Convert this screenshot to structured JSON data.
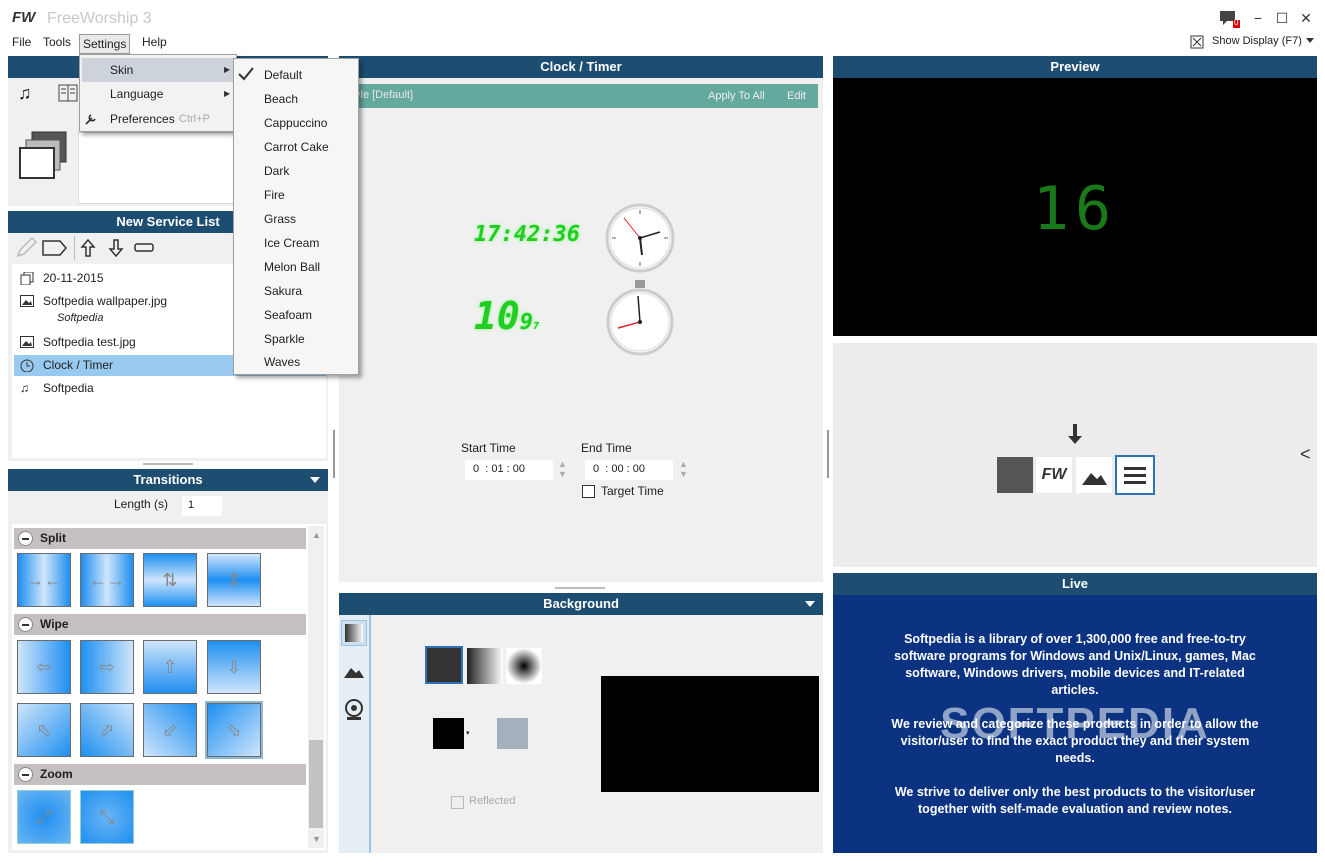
{
  "app": {
    "logo": "FW",
    "title": "FreeWorship 3"
  },
  "window_controls": {
    "notify": "0",
    "minimize": "−",
    "maximize": "☐",
    "close": "✕"
  },
  "menubar": [
    {
      "label": "File"
    },
    {
      "label": "Tools"
    },
    {
      "label": "Settings"
    },
    {
      "label": "Help"
    }
  ],
  "show_display": {
    "label": "Show Display (F7)"
  },
  "settings_menu": {
    "skin": "Skin",
    "language": "Language",
    "preferences": "Preferences",
    "preferences_shortcut": "Ctrl+P"
  },
  "skins": [
    "Default",
    "Beach",
    "Cappuccino",
    "Carrot Cake",
    "Dark",
    "Fire",
    "Grass",
    "Ice Cream",
    "Melon Ball",
    "Sakura",
    "Seafoam",
    "Sparkle",
    "Waves"
  ],
  "selected_skin": "Default",
  "service_list": {
    "title": "New Service List",
    "items": [
      {
        "label": "20-11-2015",
        "sub": "",
        "icon": "pages-icon"
      },
      {
        "label": "Softpedia wallpaper.jpg",
        "sub": "Softpedia",
        "icon": "image-icon"
      },
      {
        "label": "Softpedia test.jpg",
        "sub": "",
        "icon": "image-icon"
      },
      {
        "label": "Clock / Timer",
        "sub": "",
        "icon": "clock-icon"
      },
      {
        "label": "Softpedia",
        "sub": "",
        "icon": "music-icon"
      }
    ]
  },
  "transitions": {
    "title": "Transitions",
    "length_label": "Length  (s)",
    "length_value": "1",
    "sections": [
      {
        "name": "Split"
      },
      {
        "name": "Wipe"
      },
      {
        "name": "Zoom"
      }
    ]
  },
  "clock_timer": {
    "title": "Clock / Timer",
    "style_label": "yle [Default]",
    "apply_all": "Apply To All",
    "edit": "Edit",
    "digital_time": "17:42:36",
    "stopwatch": "10",
    "stopwatch_small": "9",
    "stopwatch_tiny": "7",
    "start_time_label": "Start Time",
    "start_time_value": "0  : 01 : 00",
    "end_time_label": "End Time",
    "end_time_value": "0  : 00 : 00",
    "target_time_label": "Target Time"
  },
  "background": {
    "title": "Background",
    "reflected_label": "Reflected"
  },
  "preview": {
    "title": "Preview",
    "number": "16"
  },
  "live": {
    "title": "Live",
    "watermark": "SOFTPEDIA",
    "paragraphs": [
      "Softpedia is a library of over 1,300,000 free and free-to-try software programs for Windows and Unix/Linux, games, Mac software, Windows drivers, mobile devices and IT-related articles.",
      "We review and categorize these products in order to allow the visitor/user to find the exact product they and their system needs.",
      "We strive to deliver only the best products to the visitor/user together with self-made evaluation and review notes."
    ]
  },
  "layers": {
    "fw_label": "FW",
    "collapse": "<"
  },
  "colors": {
    "panel_header": "#1d4e72",
    "selected_row": "#99c9ee",
    "live_bg": "#0b3382",
    "clock_green": "#22cc22"
  }
}
